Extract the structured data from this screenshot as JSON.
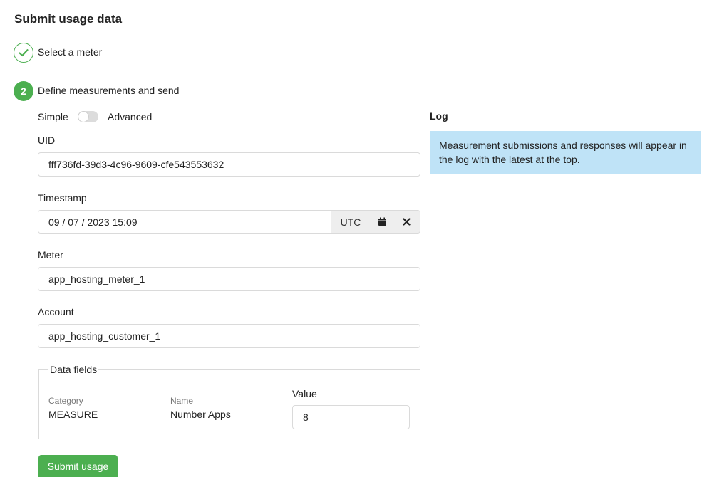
{
  "page": {
    "title": "Submit usage data"
  },
  "steps": [
    {
      "label": "Select a meter",
      "status": "complete"
    },
    {
      "number": "2",
      "label": "Define measurements and send",
      "status": "active"
    }
  ],
  "mode": {
    "simple_label": "Simple",
    "advanced_label": "Advanced",
    "advanced_enabled": false
  },
  "form": {
    "uid": {
      "label": "UID",
      "value": "fff736fd-39d3-4c96-9609-cfe543553632"
    },
    "timestamp": {
      "label": "Timestamp",
      "value": "09 / 07 / 2023 15:09",
      "timezone": "UTC"
    },
    "meter": {
      "label": "Meter",
      "value": "app_hosting_meter_1"
    },
    "account": {
      "label": "Account",
      "value": "app_hosting_customer_1"
    }
  },
  "data_fields": {
    "legend": "Data fields",
    "category_label": "Category",
    "category_value": "MEASURE",
    "name_label": "Name",
    "name_value": "Number Apps",
    "value_label": "Value",
    "value": "8"
  },
  "submit": {
    "label": "Submit usage"
  },
  "log": {
    "title": "Log",
    "message": "Measurement submissions and responses will appear in the log with the latest at the top."
  },
  "colors": {
    "accent": "#4caf50",
    "info_bg": "#bfe3f7",
    "border": "#dadada",
    "addon_bg": "#eeeeee"
  }
}
